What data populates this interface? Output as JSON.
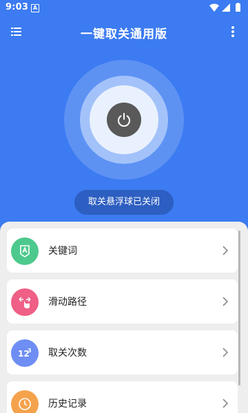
{
  "status_bar": {
    "time": "9:03",
    "notification_icon": "a-box-icon"
  },
  "app_bar": {
    "title": "一键取关通用版",
    "menu_icon": "menu-icon",
    "more_icon": "more-vert-icon"
  },
  "power": {
    "state_text": "取关悬浮球已关闭",
    "icon": "power-icon"
  },
  "menu_items": [
    {
      "label": "关键词",
      "icon": "keyword-icon",
      "color": "#4dc98d"
    },
    {
      "label": "滑动路径",
      "icon": "swipe-path-icon",
      "color": "#ef5f86"
    },
    {
      "label": "取关次数",
      "icon": "count-icon",
      "color": "#6e8ef3"
    },
    {
      "label": "历史记录",
      "icon": "history-icon",
      "color": "#f5a24c"
    }
  ],
  "colors": {
    "background": "#3c7bf1",
    "power_button": "#595959",
    "pill": "#2d5ec1"
  }
}
